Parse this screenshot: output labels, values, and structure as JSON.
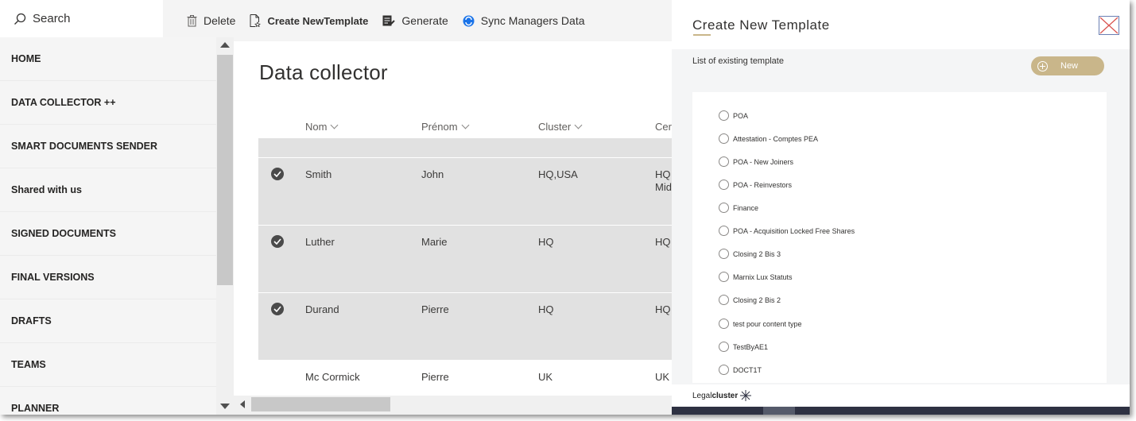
{
  "search": {
    "label": "Search"
  },
  "toolbar": {
    "delete": "Delete",
    "create_template": "Create NewTemplate",
    "generate": "Generate",
    "sync": "Sync Managers Data"
  },
  "nav": {
    "items": [
      {
        "label": "HOME"
      },
      {
        "label": "DATA COLLECTOR ++"
      },
      {
        "label": "SMART DOCUMENTS SENDER"
      },
      {
        "label": "Shared with us"
      },
      {
        "label": "SIGNED DOCUMENTS"
      },
      {
        "label": "FINAL VERSIONS"
      },
      {
        "label": "DRAFTS"
      },
      {
        "label": "TEAMS"
      },
      {
        "label": "PLANNER"
      }
    ]
  },
  "main": {
    "title": "Data collector",
    "columns": [
      "Nom",
      "Prénom",
      "Cluster",
      "Cer"
    ],
    "rows": [
      {
        "nom": "Smith",
        "prenom": "John",
        "cluster": "HQ,USA",
        "cer": "HQ",
        "cer2": "Mid",
        "selected": true
      },
      {
        "nom": "Luther",
        "prenom": "Marie",
        "cluster": "HQ",
        "cer": "HQ",
        "cer2": "",
        "selected": true
      },
      {
        "nom": "Durand",
        "prenom": "Pierre",
        "cluster": "HQ",
        "cer": "HQ",
        "cer2": "",
        "selected": true
      },
      {
        "nom": "Mc Cormick",
        "prenom": "Pierre",
        "cluster": "UK",
        "cer": "UK",
        "cer2": "",
        "selected": false
      }
    ]
  },
  "panel": {
    "title": "Create New Template",
    "subtitle": "List of existing template",
    "new_label": "New",
    "templates": [
      "POA",
      "Attestation - Comptes PEA",
      "POA - New Joiners",
      "POA - Reinvestors",
      "Finance",
      "POA - Acquisition Locked Free Shares",
      "Closing 2 Bis 3",
      "Marnix Lux Statuts",
      "Closing 2 Bis 2",
      "test pour content type",
      "TestByAE1",
      "DOCT1T"
    ],
    "logo_light": "Legal",
    "logo_bold": "cluster"
  },
  "colors": {
    "accent_gold": "#c9b68a",
    "sync_blue": "#1a73e8",
    "close_red": "#d9534f"
  }
}
